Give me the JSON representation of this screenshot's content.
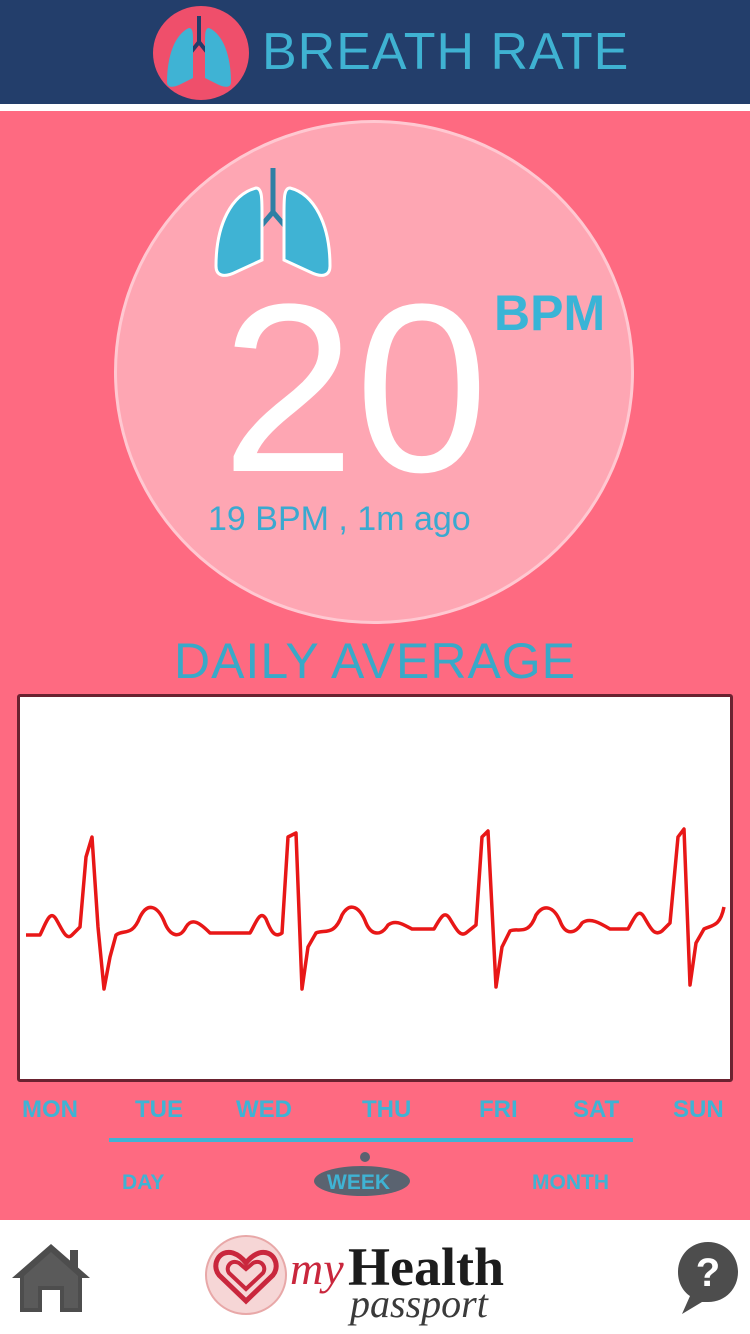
{
  "header": {
    "title": "BREATH RATE",
    "icon": "lungs-icon"
  },
  "reading": {
    "value": "20",
    "unit": "BPM",
    "previous": "19 BPM , 1m ago"
  },
  "chart_section": {
    "title": "DAILY AVERAGE"
  },
  "days": [
    "MON",
    "TUE",
    "WED",
    "THU",
    "FRI",
    "SAT",
    "SUN"
  ],
  "range_options": [
    "DAY",
    "WEEK",
    "MONTH"
  ],
  "selected_range": "WEEK",
  "brand": {
    "my": "my",
    "health": "Health",
    "passport": "passport"
  },
  "nav": {
    "home_icon": "home-icon",
    "help_icon": "help-bubble-icon"
  },
  "colors": {
    "header_bg": "#233e6b",
    "main_bg": "#fe6a81",
    "accent": "#3fb3d4",
    "waveform": "#e81717"
  }
}
